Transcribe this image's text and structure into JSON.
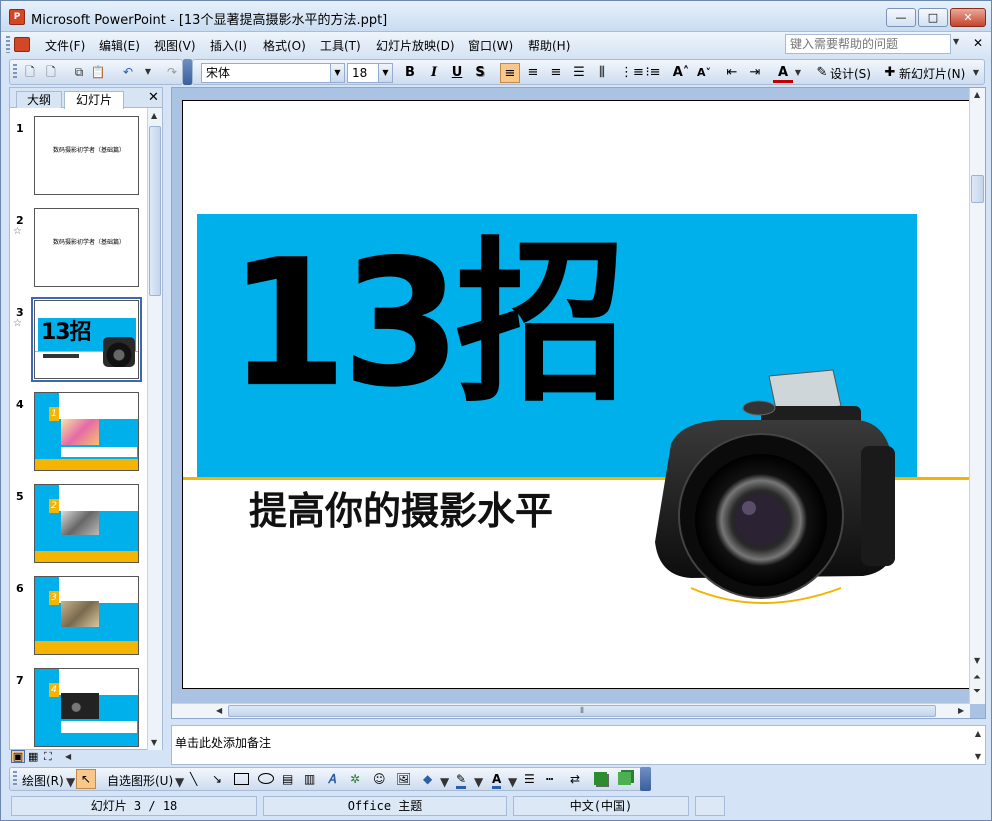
{
  "window": {
    "title": "Microsoft PowerPoint - [13个显著提高摄影水平的方法.ppt]",
    "app_icon_letter": "P",
    "minimize_label": "—",
    "maximize_label": "□",
    "close_label": "✕"
  },
  "menu": {
    "items": [
      "文件(F)",
      "编辑(E)",
      "视图(V)",
      "插入(I)",
      "格式(O)",
      "工具(T)",
      "幻灯片放映(D)",
      "窗口(W)",
      "帮助(H)"
    ],
    "help_placeholder": "键入需要帮助的问题"
  },
  "format_toolbar": {
    "font_name": "宋体",
    "font_size": "18",
    "bold": "B",
    "italic": "I",
    "underline": "U",
    "shadow": "S",
    "design_label": "设计(S)",
    "new_slide_label": "新幻灯片(N)"
  },
  "left_panel": {
    "tabs": [
      "大纲",
      "幻灯片"
    ],
    "selected_tab": "幻灯片",
    "thumbs": [
      {
        "num": "1",
        "text": "数码摄影初学者（基础篇）"
      },
      {
        "num": "2",
        "text": "数码摄影初学者（基础篇）"
      },
      {
        "num": "3",
        "text": "13招"
      },
      {
        "num": "4",
        "step": "1"
      },
      {
        "num": "5",
        "step": "2"
      },
      {
        "num": "6",
        "step": "3"
      },
      {
        "num": "7",
        "step": "4"
      }
    ]
  },
  "slide": {
    "title": "13招",
    "subtitle": "提高你的摄影水平",
    "banner_color": "#00b0ea",
    "line_color": "#f4b400"
  },
  "notes": {
    "placeholder": "单击此处添加备注"
  },
  "draw_toolbar": {
    "draw_label": "绘图(R)",
    "autoshapes_label": "自选图形(U)"
  },
  "status": {
    "slide_info": "幻灯片 3 / 18",
    "theme": "Office 主题",
    "language": "中文(中国)"
  }
}
